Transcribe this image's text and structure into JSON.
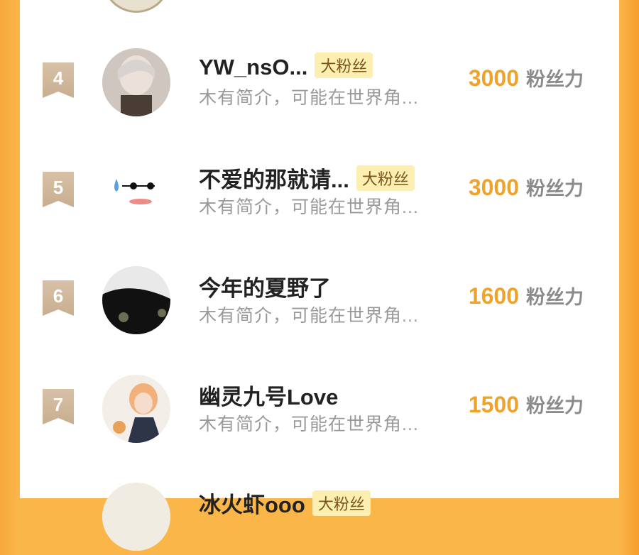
{
  "colors": {
    "accent": "#f0a32a",
    "badge_bg": "#fdefb2",
    "rank_tag": "#d0b596"
  },
  "unit_label": "粉丝力",
  "rows": [
    {
      "rank": "4",
      "name": "YW_nsO...",
      "badge": "大粉丝",
      "bio": "木有简介，可能在世界角...",
      "score": "3000"
    },
    {
      "rank": "5",
      "name": "不爱的那就请...",
      "badge": "大粉丝",
      "bio": "木有简介，可能在世界角...",
      "score": "3000"
    },
    {
      "rank": "6",
      "name": "今年的夏野了",
      "badge": "",
      "bio": "木有简介，可能在世界角...",
      "score": "1600"
    },
    {
      "rank": "7",
      "name": "幽灵九号Love",
      "badge": "",
      "bio": "木有简介，可能在世界角...",
      "score": "1500"
    },
    {
      "rank": "",
      "name": "冰火虾ooo",
      "badge": "大粉丝",
      "bio": "",
      "score": ""
    }
  ]
}
